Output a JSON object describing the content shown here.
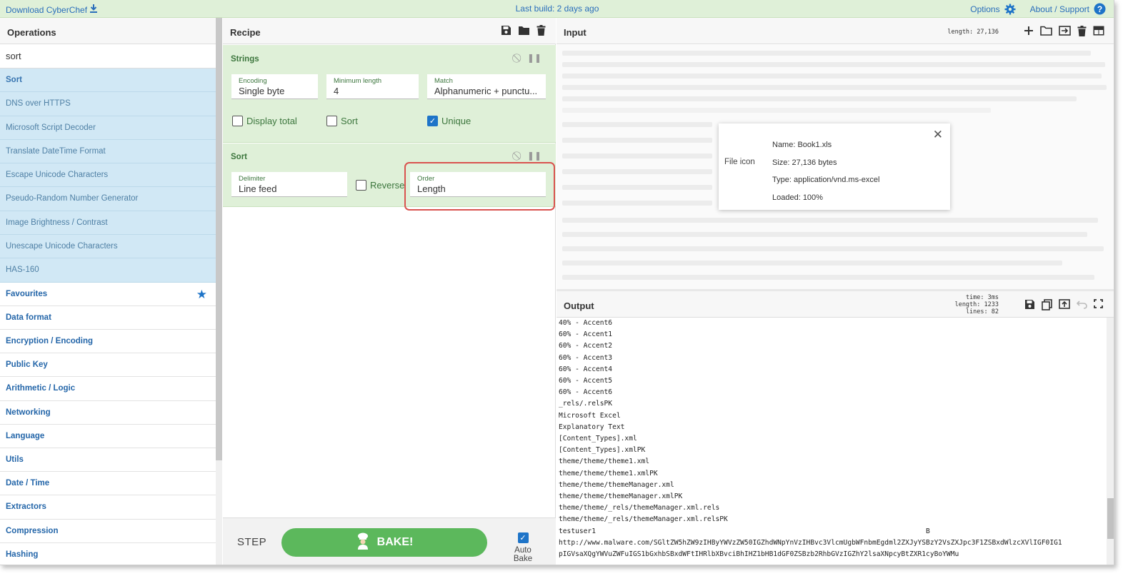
{
  "banner": {
    "download": "Download CyberChef",
    "last_build": "Last build: 2 days ago",
    "options": "Options",
    "about": "About / Support"
  },
  "operations": {
    "title": "Operations",
    "search_value": "sort",
    "results": [
      "Sort",
      "DNS over HTTPS",
      "Microsoft Script Decoder",
      "Translate DateTime Format",
      "Escape Unicode Characters",
      "Pseudo-Random Number Generator",
      "Image Brightness / Contrast",
      "Unescape Unicode Characters",
      "HAS-160"
    ],
    "categories": [
      "Favourites",
      "Data format",
      "Encryption / Encoding",
      "Public Key",
      "Arithmetic / Logic",
      "Networking",
      "Language",
      "Utils",
      "Date / Time",
      "Extractors",
      "Compression",
      "Hashing"
    ]
  },
  "recipe": {
    "title": "Recipe",
    "strings": {
      "name": "Strings",
      "encoding_label": "Encoding",
      "encoding_value": "Single byte",
      "minlen_label": "Minimum length",
      "minlen_value": "4",
      "match_label": "Match",
      "match_value": "Alphanumeric + punctu...",
      "display_total": "Display total",
      "sort": "Sort",
      "unique": "Unique",
      "unique_checked": true
    },
    "sort": {
      "name": "Sort",
      "delimiter_label": "Delimiter",
      "delimiter_value": "Line feed",
      "reverse": "Reverse",
      "order_label": "Order",
      "order_value": "Length"
    },
    "step": "STEP",
    "bake": "BAKE!",
    "auto_bake": "Auto Bake",
    "auto_bake_checked": true
  },
  "input": {
    "title": "Input",
    "length_label": "length: 27,136",
    "file": {
      "icon_alt": "File icon",
      "name": "Name: Book1.xls",
      "size": "Size: 27,136 bytes",
      "type": "Type: application/vnd.ms-excel",
      "loaded": "Loaded: 100%"
    }
  },
  "output": {
    "title": "Output",
    "time": "time:  3ms",
    "length": "length: 1233",
    "lines": "lines:   82",
    "text_lines": [
      "40% - Accent6",
      "60% - Accent1",
      "60% - Accent2",
      "60% - Accent3",
      "60% - Accent4",
      "60% - Accent5",
      "60% - Accent6",
      "_rels/.relsPK",
      "Microsoft Excel",
      "Explanatory Text",
      "[Content_Types].xml",
      "[Content_Types].xmlPK",
      "theme/theme/theme1.xml",
      "theme/theme/theme1.xmlPK",
      "theme/theme/themeManager.xml",
      "theme/theme/themeManager.xmlPK",
      "theme/theme/_rels/themeManager.xml.rels",
      "theme/theme/_rels/themeManager.xml.relsPK",
      "testuser1                                                                                B",
      "http://www.malware.com/SGltZW5hZW9zIHByYWVzZW50IGZhdWNpYnVzIHBvc3VlcmUgbWFnbmEgdml2ZXJyYSBzY2VsZXJpc3F1ZSBxdWlzcXVlIGF0IG1",
      "pIGVsaXQgYWVuZWFuIGS1bGxhbSBxdWFtIHRlbXBvciBhIHZ1bHB1dGF0ZSBzb2RhbGVzIGZhY2lsaXNpcyBtZXR1cyBoYWMu"
    ]
  },
  "colors": {
    "banner_bg": "#dff0d8",
    "op_result_bg": "#d1e8f5",
    "recipe_op_bg": "#dff0d8",
    "bake_green": "#5cb85c",
    "highlight_red": "#d9534f",
    "link_blue": "#2a6ebb"
  },
  "icons": {
    "download": "download-icon",
    "options": "gear-icon",
    "about": "help-icon",
    "favourites": "star-icon"
  }
}
